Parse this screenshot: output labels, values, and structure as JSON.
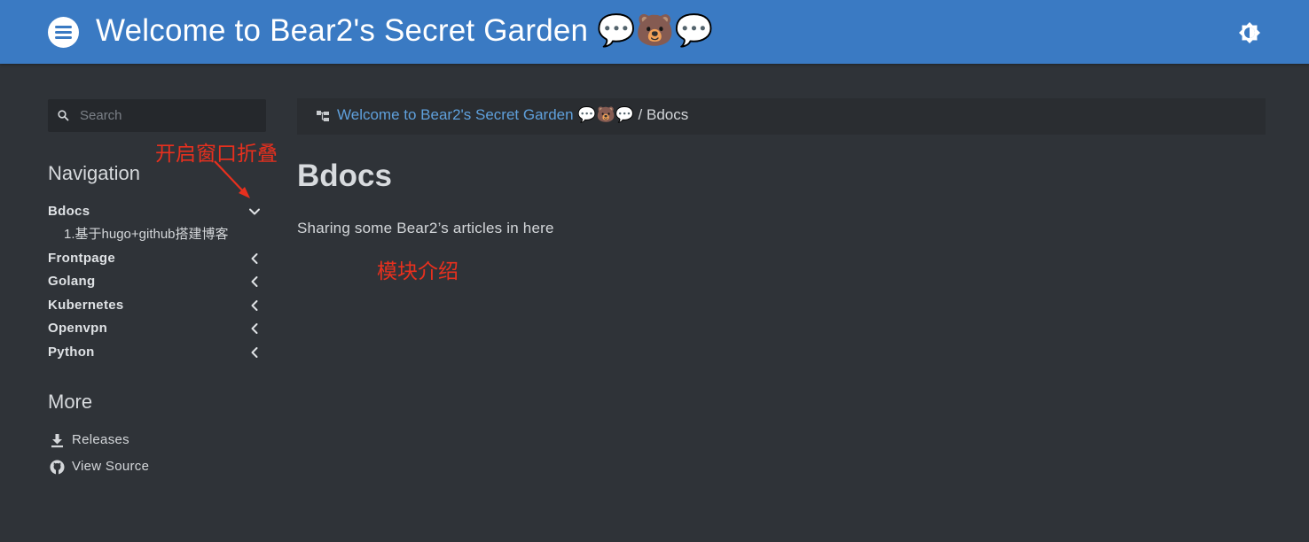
{
  "header": {
    "title": "Welcome to Bear2's Secret Garden 💬🐻💬",
    "menu_icon": "menu-icon",
    "theme_icon": "brightness-icon"
  },
  "search": {
    "placeholder": "Search",
    "value": ""
  },
  "sidebar": {
    "navigation_heading": "Navigation",
    "items": [
      {
        "label": "Bdocs",
        "expanded": true,
        "children": [
          "1.基于hugo+github搭建博客"
        ]
      },
      {
        "label": "Frontpage",
        "expanded": false
      },
      {
        "label": "Golang",
        "expanded": false
      },
      {
        "label": "Kubernetes",
        "expanded": false
      },
      {
        "label": "Openvpn",
        "expanded": false
      },
      {
        "label": "Python",
        "expanded": false
      }
    ],
    "more_heading": "More",
    "more_items": [
      {
        "label": "Releases",
        "icon": "download-icon"
      },
      {
        "label": "View Source",
        "icon": "github-icon"
      }
    ]
  },
  "breadcrumb": {
    "home": "Welcome to Bear2's Secret Garden 💬🐻💬",
    "separator": "/",
    "current": "Bdocs"
  },
  "main": {
    "title": "Bdocs",
    "description": "Sharing some Bear2’s articles in here"
  },
  "annotations": {
    "collapse_note": "开启窗口折叠",
    "module_note": "模块介绍"
  },
  "colors": {
    "header": "#3a7ac3",
    "background": "#2f3338",
    "link": "#5fa0dc",
    "annotation": "#e8301e"
  }
}
